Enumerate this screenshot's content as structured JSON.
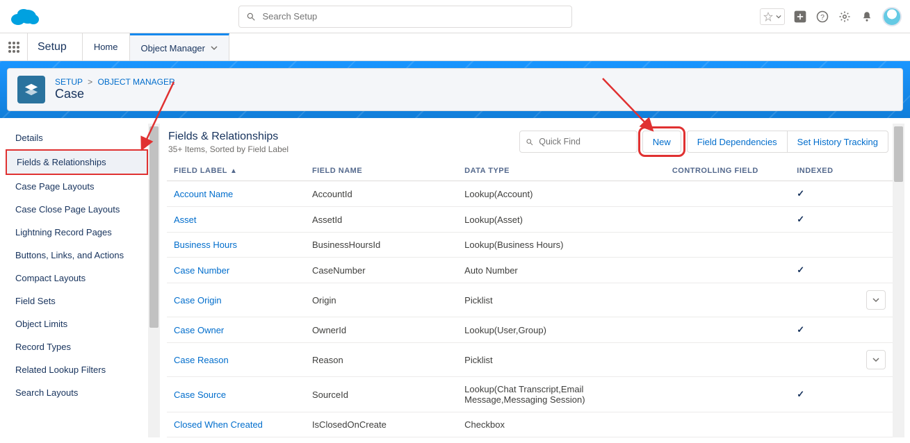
{
  "header": {
    "search_placeholder": "Search Setup"
  },
  "context": {
    "app_title": "Setup",
    "tab_home": "Home",
    "tab_object_manager": "Object Manager"
  },
  "page": {
    "breadcrumb_setup": "SETUP",
    "breadcrumb_sep": ">",
    "breadcrumb_om": "OBJECT MANAGER",
    "title": "Case"
  },
  "sidebar": {
    "items": [
      "Details",
      "Fields & Relationships",
      "Case Page Layouts",
      "Case Close Page Layouts",
      "Lightning Record Pages",
      "Buttons, Links, and Actions",
      "Compact Layouts",
      "Field Sets",
      "Object Limits",
      "Record Types",
      "Related Lookup Filters",
      "Search Layouts"
    ],
    "active_index": 1
  },
  "main": {
    "title": "Fields & Relationships",
    "subtitle": "35+ Items, Sorted by Field Label",
    "quickfind_placeholder": "Quick Find",
    "btn_new": "New",
    "btn_field_deps": "Field Dependencies",
    "btn_history": "Set History Tracking",
    "columns": {
      "label": "FIELD LABEL",
      "name": "FIELD NAME",
      "type": "DATA TYPE",
      "controlling": "CONTROLLING FIELD",
      "indexed": "INDEXED"
    },
    "rows": [
      {
        "label": "Account Name",
        "name": "AccountId",
        "type": "Lookup(Account)",
        "indexed": true,
        "menu": false
      },
      {
        "label": "Asset",
        "name": "AssetId",
        "type": "Lookup(Asset)",
        "indexed": true,
        "menu": false
      },
      {
        "label": "Business Hours",
        "name": "BusinessHoursId",
        "type": "Lookup(Business Hours)",
        "indexed": false,
        "menu": false
      },
      {
        "label": "Case Number",
        "name": "CaseNumber",
        "type": "Auto Number",
        "indexed": true,
        "menu": false
      },
      {
        "label": "Case Origin",
        "name": "Origin",
        "type": "Picklist",
        "indexed": false,
        "menu": true
      },
      {
        "label": "Case Owner",
        "name": "OwnerId",
        "type": "Lookup(User,Group)",
        "indexed": true,
        "menu": false
      },
      {
        "label": "Case Reason",
        "name": "Reason",
        "type": "Picklist",
        "indexed": false,
        "menu": true
      },
      {
        "label": "Case Source",
        "name": "SourceId",
        "type": "Lookup(Chat Transcript,Email Message,Messaging Session)",
        "indexed": true,
        "menu": false
      },
      {
        "label": "Closed When Created",
        "name": "IsClosedOnCreate",
        "type": "Checkbox",
        "indexed": false,
        "menu": false
      }
    ]
  }
}
